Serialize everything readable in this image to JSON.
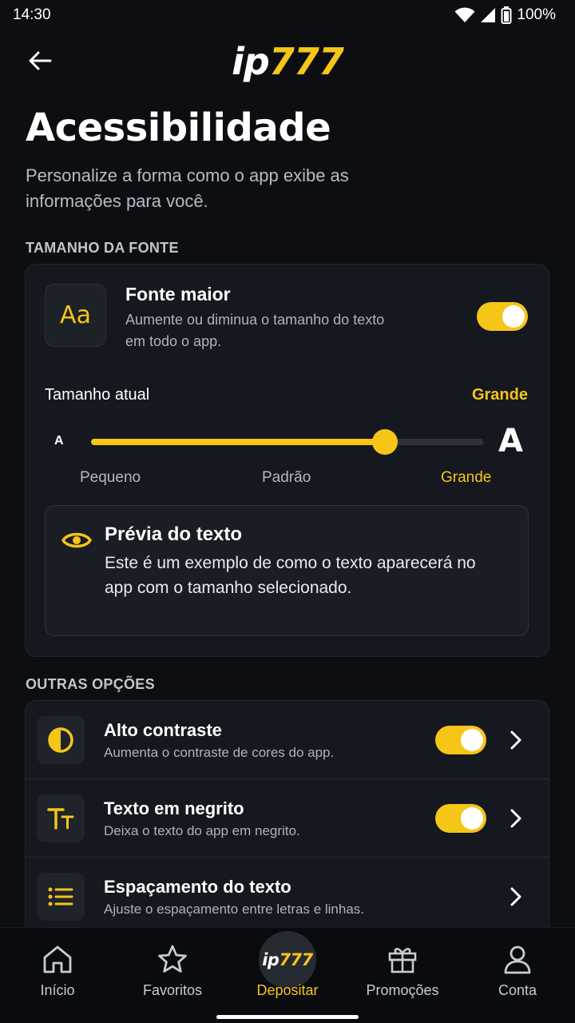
{
  "status_bar": {
    "time": "14:30",
    "battery": "100%"
  },
  "header": {
    "logo_ip": "ip",
    "logo_num": "777"
  },
  "page": {
    "title": "Acessibilidade",
    "subtitle": "Personalize a forma como o app exibe as informações para você."
  },
  "font_section": {
    "label": "TAMANHO DA FONTE",
    "icon_text": "Aa",
    "title": "Fonte maior",
    "description": "Aumente ou diminua o tamanho do texto em todo o app.",
    "toggle_on": true,
    "current_label": "Tamanho atual",
    "current_value": "Grande",
    "slider_min_glyph": "A",
    "slider_max_glyph": "A",
    "slider_level": 0.75,
    "ticks": [
      "Pequeno",
      "Padrão",
      "Grande"
    ],
    "preview": {
      "title": "Prévia do texto",
      "text": "Este é um exemplo de como o texto aparecerá no app com o tamanho selecionado."
    }
  },
  "other_section": {
    "label": "OUTRAS OPÇÕES",
    "items": [
      {
        "title": "Alto contraste",
        "description": "Aumenta o contraste de cores do app.",
        "icon": "contrast-icon",
        "toggle_on": true
      },
      {
        "title": "Texto em negrito",
        "description": "Deixa o texto do app em negrito.",
        "icon": "text-size-icon",
        "toggle_on": true
      },
      {
        "title": "Espaçamento do texto",
        "description": "Ajuste o espaçamento entre letras e linhas.",
        "icon": "list-spacing-icon"
      }
    ]
  },
  "bottom_nav": {
    "items": [
      {
        "label": "Início",
        "icon": "home-icon"
      },
      {
        "label": "Favoritos",
        "icon": "star-icon"
      },
      {
        "label": "Depositar",
        "icon": "ip777-logo",
        "logo_ip": "ip",
        "logo_num": "777",
        "active": true
      },
      {
        "label": "Promoções",
        "icon": "gift-icon"
      },
      {
        "label": "Conta",
        "icon": "user-icon"
      }
    ]
  },
  "colors": {
    "accent": "#f5c518",
    "background": "#0c0e12",
    "card": "#15181e"
  }
}
